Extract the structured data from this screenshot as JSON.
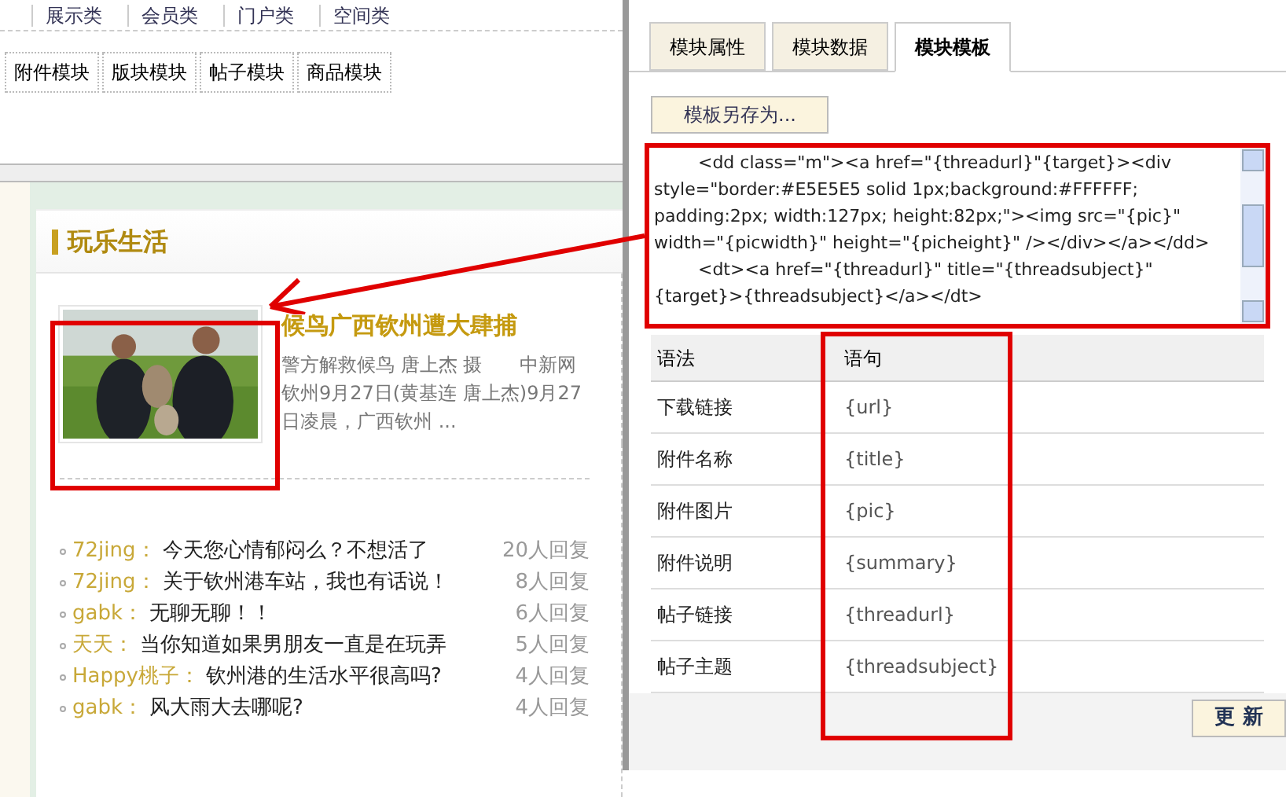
{
  "nav_links": [
    "展示类",
    "会员类",
    "门户类",
    "空间类"
  ],
  "module_buttons": [
    "附件模块",
    "版块模块",
    "帖子模块",
    "商品模块"
  ],
  "section": {
    "title": "玩乐生活",
    "feature": {
      "headline": "候鸟广西钦州遭大肆捕",
      "summary": "警方解救候鸟 唐上杰 摄　　中新网钦州9月27日(黄基连 唐上杰)9月27日凌晨，广西钦州 ..."
    },
    "threads": [
      {
        "author": "72jing：",
        "subject": "今天您心情郁闷么？不想活了",
        "replies": "20人回复"
      },
      {
        "author": "72jing：",
        "subject": "关于钦州港车站，我也有话说！",
        "replies": "8人回复"
      },
      {
        "author": "gabk：",
        "subject": "无聊无聊！！",
        "replies": "6人回复"
      },
      {
        "author": "天天：",
        "subject": "当你知道如果男朋友一直是在玩弄",
        "replies": "5人回复"
      },
      {
        "author": "Happy桃子：",
        "subject": "钦州港的生活水平很高吗?",
        "replies": "4人回复"
      },
      {
        "author": "gabk：",
        "subject": "风大雨大去哪呢?",
        "replies": "4人回复"
      }
    ]
  },
  "dialog": {
    "tabs": [
      {
        "label": "模块属性",
        "selected": false
      },
      {
        "label": "模块数据",
        "selected": false
      },
      {
        "label": "模块模板",
        "selected": true
      }
    ],
    "save_as_button": "模板另存为...",
    "template_code": [
      "\t\t<dd class=\"m\"><a href=\"{threadurl}\"{target}><div style=\"border:#E5E5E5 solid 1px;background:#FFFFFF; padding:2px; width:127px; height:82px;\"><img src=\"{pic}\" width=\"{picwidth}\" height=\"{picheight}\" /></div></a></dd>",
      "\t\t<dt><a href=\"{threadurl}\" title=\"{threadsubject}\"{target}>{threadsubject}</a></dt>"
    ],
    "syntax_table": {
      "columns": [
        "语法",
        "语句"
      ],
      "rows": [
        [
          "下载链接",
          "{url}"
        ],
        [
          "附件名称",
          "{title}"
        ],
        [
          "附件图片",
          "{pic}"
        ],
        [
          "附件说明",
          "{summary}"
        ],
        [
          "帖子链接",
          "{threadurl}"
        ],
        [
          "帖子主题",
          "{threadsubject}"
        ]
      ]
    },
    "update_button": "更 新"
  }
}
